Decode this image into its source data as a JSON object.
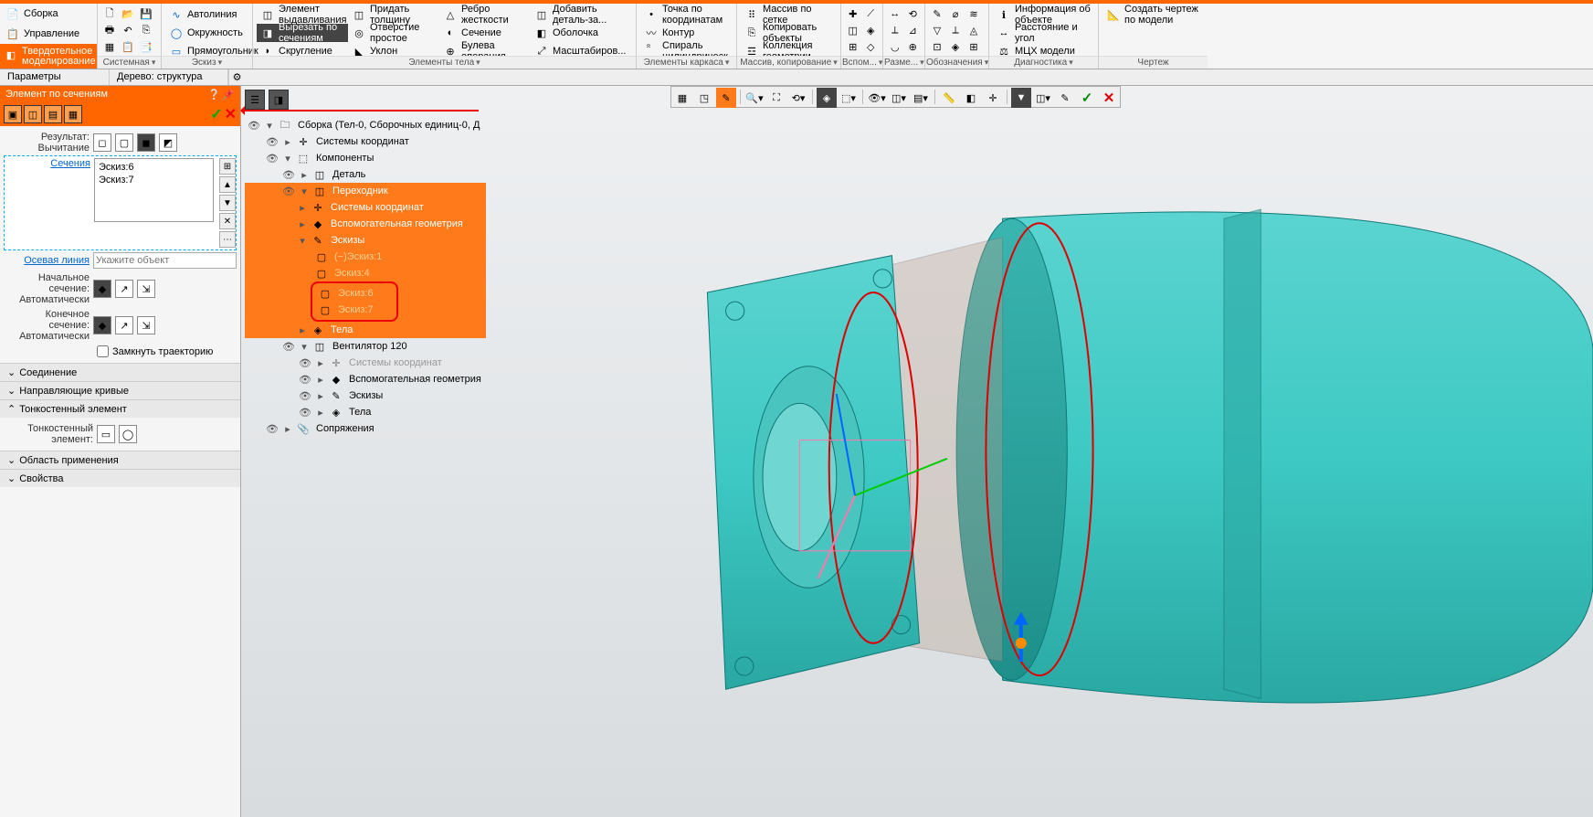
{
  "ribbon": {
    "left": {
      "assembly": "Сборка",
      "management": "Управление",
      "solid_modeling": "Твердотельное моделирование"
    },
    "groups": {
      "system_footer": "Системная",
      "sketch_footer": "Эскиз",
      "sketch": {
        "autoline": "Автолиния",
        "circle": "Окружность",
        "rectangle": "Прямоугольник"
      },
      "body_footer": "Элементы тела",
      "body": {
        "extrude_element": "Элемент выдавливания",
        "cut_by_sections": "Вырезать по сечениям",
        "fillet": "Скругление",
        "thicken": "Придать толщину",
        "hole_simple": "Отверстие простое",
        "draft": "Уклон",
        "rib": "Ребро жесткости",
        "section": "Сечение",
        "boolean": "Булева операция",
        "add_part": "Добавить деталь-за...",
        "shell": "Оболочка",
        "scale": "Масштабиров..."
      },
      "frame_footer": "Элементы каркаса",
      "frame": {
        "point_by_coords": "Точка по координатам",
        "contour": "Контур",
        "cyl_spiral": "Спираль цилиндрическ..."
      },
      "array_footer": "Массив, копирование",
      "array": {
        "grid_array": "Массив по сетке",
        "copy_objects": "Копировать объекты",
        "geom_collection": "Коллекция геометрии"
      },
      "aux_footer": "Вспом...",
      "dim_footer": "Разме...",
      "annot_footer": "Обозначения",
      "annot": {
        "object_info": "Информация об объекте",
        "dist_angle": "Расстояние и угол",
        "mcx_model": "МЦХ модели"
      },
      "diag_footer": "Диагностика",
      "draw_footer": "Чертеж",
      "draw": {
        "create_drawing": "Создать чертеж по модели"
      }
    }
  },
  "panels": {
    "params": "Параметры",
    "tree": "Дерево: структура"
  },
  "params": {
    "title": "Элемент по сечениям",
    "result_label": "Результат:",
    "result_value": "Вычитание",
    "sections_label": "Сечения",
    "sections": [
      "Эскиз:6",
      "Эскиз:7"
    ],
    "axis_label": "Осевая линия",
    "axis_placeholder": "Укажите объект",
    "start_section": "Начальное сечение:",
    "end_section": "Конечное сечение:",
    "auto": "Автоматически",
    "close_path": "Замкнуть траекторию",
    "acc_connection": "Соединение",
    "acc_guides": "Направляющие кривые",
    "acc_thin": "Тонкостенный элемент",
    "thin_label": "Тонкостенный элемент:",
    "acc_scope": "Область применения",
    "acc_props": "Свойства"
  },
  "tree": {
    "root": "Сборка (Тел-0, Сборочных единиц-0, Д",
    "csys": "Системы координат",
    "components": "Компоненты",
    "part": "Деталь",
    "adapter": "Переходник",
    "csys2": "Системы координат",
    "aux_geom": "Вспомогательная геометрия",
    "sketches": "Эскизы",
    "sk1": "(−)Эскиз:1",
    "sk4": "Эскиз:4",
    "sk6": "Эскиз:6",
    "sk7": "Эскиз:7",
    "bodies": "Тела",
    "fan": "Вентилятор 120",
    "csys3": "Системы координат",
    "aux_geom2": "Вспомогательная геометрия",
    "sketches2": "Эскизы",
    "bodies2": "Тела",
    "mates": "Сопряжения"
  }
}
